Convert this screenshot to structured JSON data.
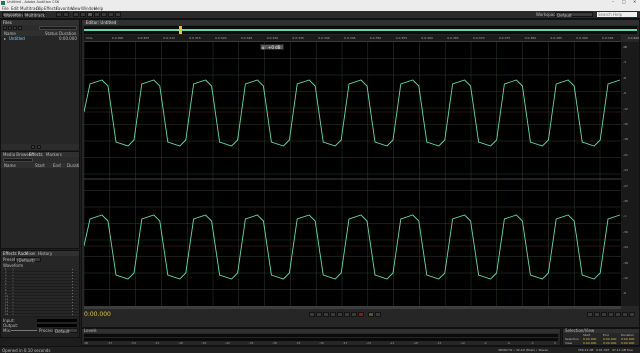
{
  "title_bar": {
    "title": "Untitled - Adobe Audition CS6"
  },
  "menu": [
    "File",
    "Edit",
    "Multitrack",
    "Clip",
    "Effects",
    "Favorites",
    "View",
    "Window",
    "Help"
  ],
  "toolbar": {
    "view_waveform": "Waveform",
    "view_multitrack": "Multitrack",
    "workspace_label": "Workspace:",
    "workspace_value": "Default",
    "search_placeholder": "Search Help"
  },
  "files_panel": {
    "tab": "Files",
    "col_name": "Name",
    "col_status": "Status",
    "col_duration": "Duration",
    "file_name": "Untitled",
    "file_duration": "0:00.000"
  },
  "media_panel": {
    "tabs": [
      "Media Browser",
      "Effects",
      "Markers"
    ],
    "col_name": "Name",
    "col_start": "Start",
    "col_end": "End",
    "col_duration": "Durati"
  },
  "effects_rack": {
    "tabs": [
      "Effects Rack",
      "Mixer",
      "History"
    ],
    "presets_label": "Presets:",
    "presets_value": "(Default)",
    "file_label": "Waveform",
    "slots": [
      "1",
      "2",
      "3",
      "4",
      "5",
      "6",
      "7",
      "8",
      "9",
      "10",
      "11",
      "12",
      "13",
      "14",
      "15",
      "16"
    ],
    "input_label": "Input:",
    "output_label": "Output:",
    "mix_label": "Mix:",
    "mix_value": "Default Mix",
    "process_label": "Process:",
    "process_value": "Default"
  },
  "editor": {
    "tab": "Editor: Untitled",
    "ruler_labels": [
      "hms",
      "0.0:300",
      "0.0:305",
      "0.0:310",
      "0.0:315",
      "0.0:320",
      "0.0:325",
      "0.0:330",
      "0.0:335",
      "0.0:340",
      "0.0:345",
      "0.0:350",
      "0.0:355",
      "0.0:360",
      "0.0:365",
      "0.0:370",
      "0.0:375",
      "0.0:380",
      "0.0:385",
      "0.0:390",
      "0.0:395",
      "0.0:400"
    ],
    "hud_value": "+0 dB",
    "db_scale": [
      "dB",
      "-3",
      "-6",
      "-9",
      "-12",
      "-15",
      "-18",
      "-21",
      "-24",
      "-27",
      "-30",
      "-∞",
      "-30",
      "-24",
      "-18",
      "-12",
      "-6"
    ],
    "time_display": "0:00.000",
    "zoom_levels": [
      "1",
      "2",
      "3"
    ]
  },
  "level_meter": {
    "tab": "Levels",
    "scale": [
      "dB",
      "-57",
      "-54",
      "-51",
      "-48",
      "-45",
      "-42",
      "-39",
      "-36",
      "-33",
      "-30",
      "-27",
      "-24",
      "-21",
      "-18",
      "-15",
      "-12",
      "-9",
      "-6",
      "-3",
      "0"
    ]
  },
  "selection_view": {
    "tab": "Selection/View",
    "col_start": "Start",
    "col_end": "End",
    "col_duration": "Duration",
    "row_selection": "Selection",
    "row_view": "View",
    "values": [
      "0:00.000",
      "0:00.000",
      "0:00.000",
      "0:00.000",
      "0:00.000",
      "0:00.000"
    ]
  },
  "status_bar": {
    "left": "Opened in 0.10 seconds",
    "sample_rate": "48000 Hz • 32-bit (float) • Stereo",
    "file_size": "256.21 KB",
    "duration": "0:01.397",
    "free_space": "47.11 GB free"
  },
  "colors": {
    "waveform": "#6ad6a8",
    "background": "#000000",
    "accent": "#e2c04a"
  }
}
